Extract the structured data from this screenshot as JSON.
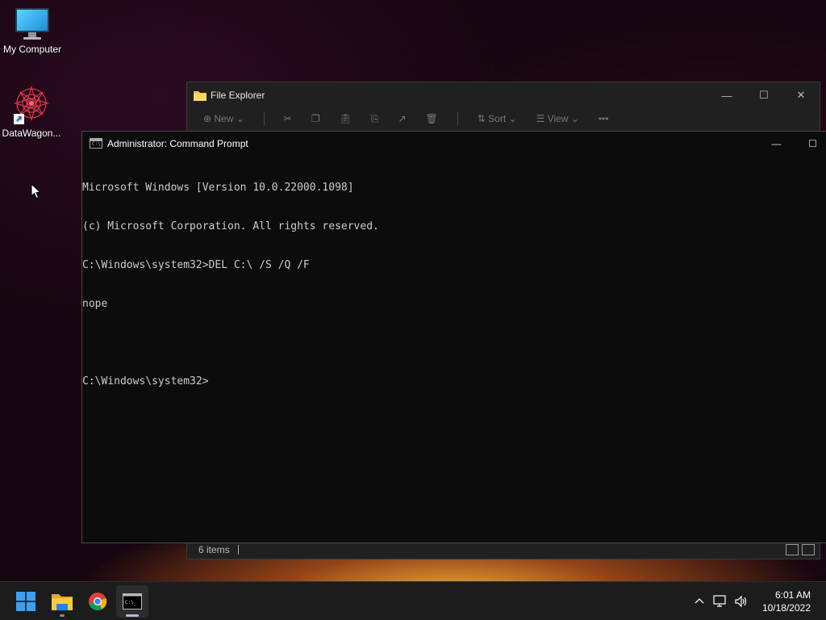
{
  "desktop": {
    "icons": [
      {
        "label": "My Computer"
      },
      {
        "label": "DataWagon..."
      }
    ]
  },
  "explorer": {
    "title": "File Explorer",
    "toolbar": {
      "new_label": "New",
      "sort_label": "Sort",
      "view_label": "View",
      "more_label": "•••"
    },
    "status_items": "6 items"
  },
  "cmd": {
    "title": "Administrator: Command Prompt",
    "lines": [
      "Microsoft Windows [Version 10.0.22000.1098]",
      "(c) Microsoft Corporation. All rights reserved.",
      "C:\\Windows\\system32>DEL C:\\ /S /Q /F",
      "nope",
      "",
      "C:\\Windows\\system32>"
    ]
  },
  "taskbar": {
    "apps": [
      {
        "name": "start",
        "icon": "windows-logo-icon"
      },
      {
        "name": "file-explorer",
        "icon": "folder-icon"
      },
      {
        "name": "chrome",
        "icon": "chrome-icon"
      },
      {
        "name": "command-prompt",
        "icon": "terminal-icon"
      }
    ],
    "tray": {
      "time": "6:01 AM",
      "date": "10/18/2022"
    }
  },
  "colors": {
    "accent": "#0078d4",
    "console_text": "#cccccc",
    "console_bg": "#0c0c0c"
  }
}
